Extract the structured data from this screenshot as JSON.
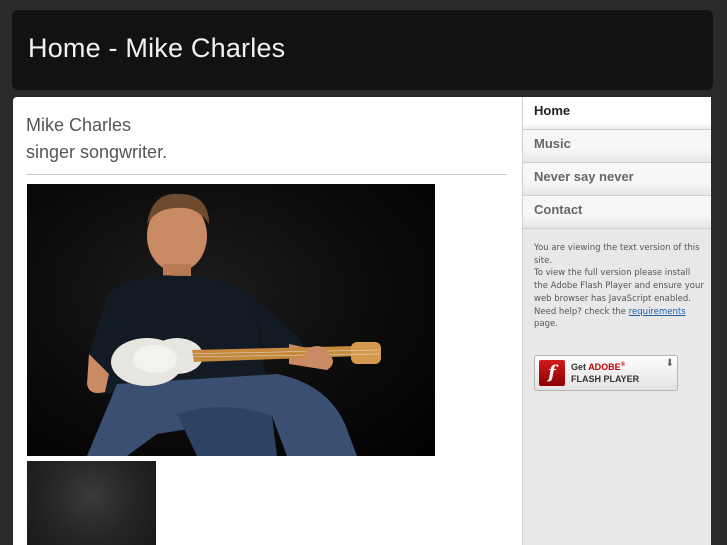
{
  "header": {
    "title": "Home - Mike Charles"
  },
  "intro": {
    "line1": "Mike Charles",
    "line2": "singer songwriter."
  },
  "nav": {
    "items": [
      {
        "label": "Home",
        "active": true
      },
      {
        "label": "Music",
        "active": false
      },
      {
        "label": "Never say never",
        "active": false
      },
      {
        "label": "Contact",
        "active": false
      }
    ]
  },
  "notice": {
    "line1": "You are viewing the text version of this site.",
    "line2": "To view the full version please install the Adobe Flash Player and ensure your web browser has JavaScript enabled.",
    "line3_prefix": "Need help? check the ",
    "line3_link": "requirements",
    "line3_suffix": " page."
  },
  "flash_button": {
    "get": "Get",
    "adobe": "ADOBE",
    "player": "FLASH PLAYER",
    "logo_glyph": "f"
  }
}
